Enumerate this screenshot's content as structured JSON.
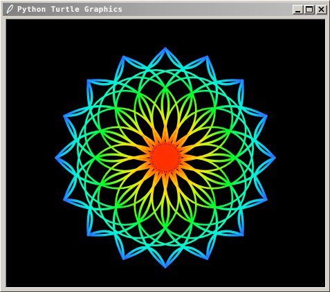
{
  "window": {
    "title": "Python Turtle Graphics",
    "icon": "feather-pen-icon",
    "controls": [
      "minimize-icon",
      "maximize-icon",
      "close-icon"
    ]
  },
  "canvas": {
    "background": "#000000",
    "figure": "rainbow rosette of arcs",
    "petal_count": 16,
    "palette": [
      "#ff2a00",
      "#ff8c00",
      "#ffff00",
      "#7fff00",
      "#00ff00",
      "#00ffff",
      "#1e90ff"
    ]
  }
}
